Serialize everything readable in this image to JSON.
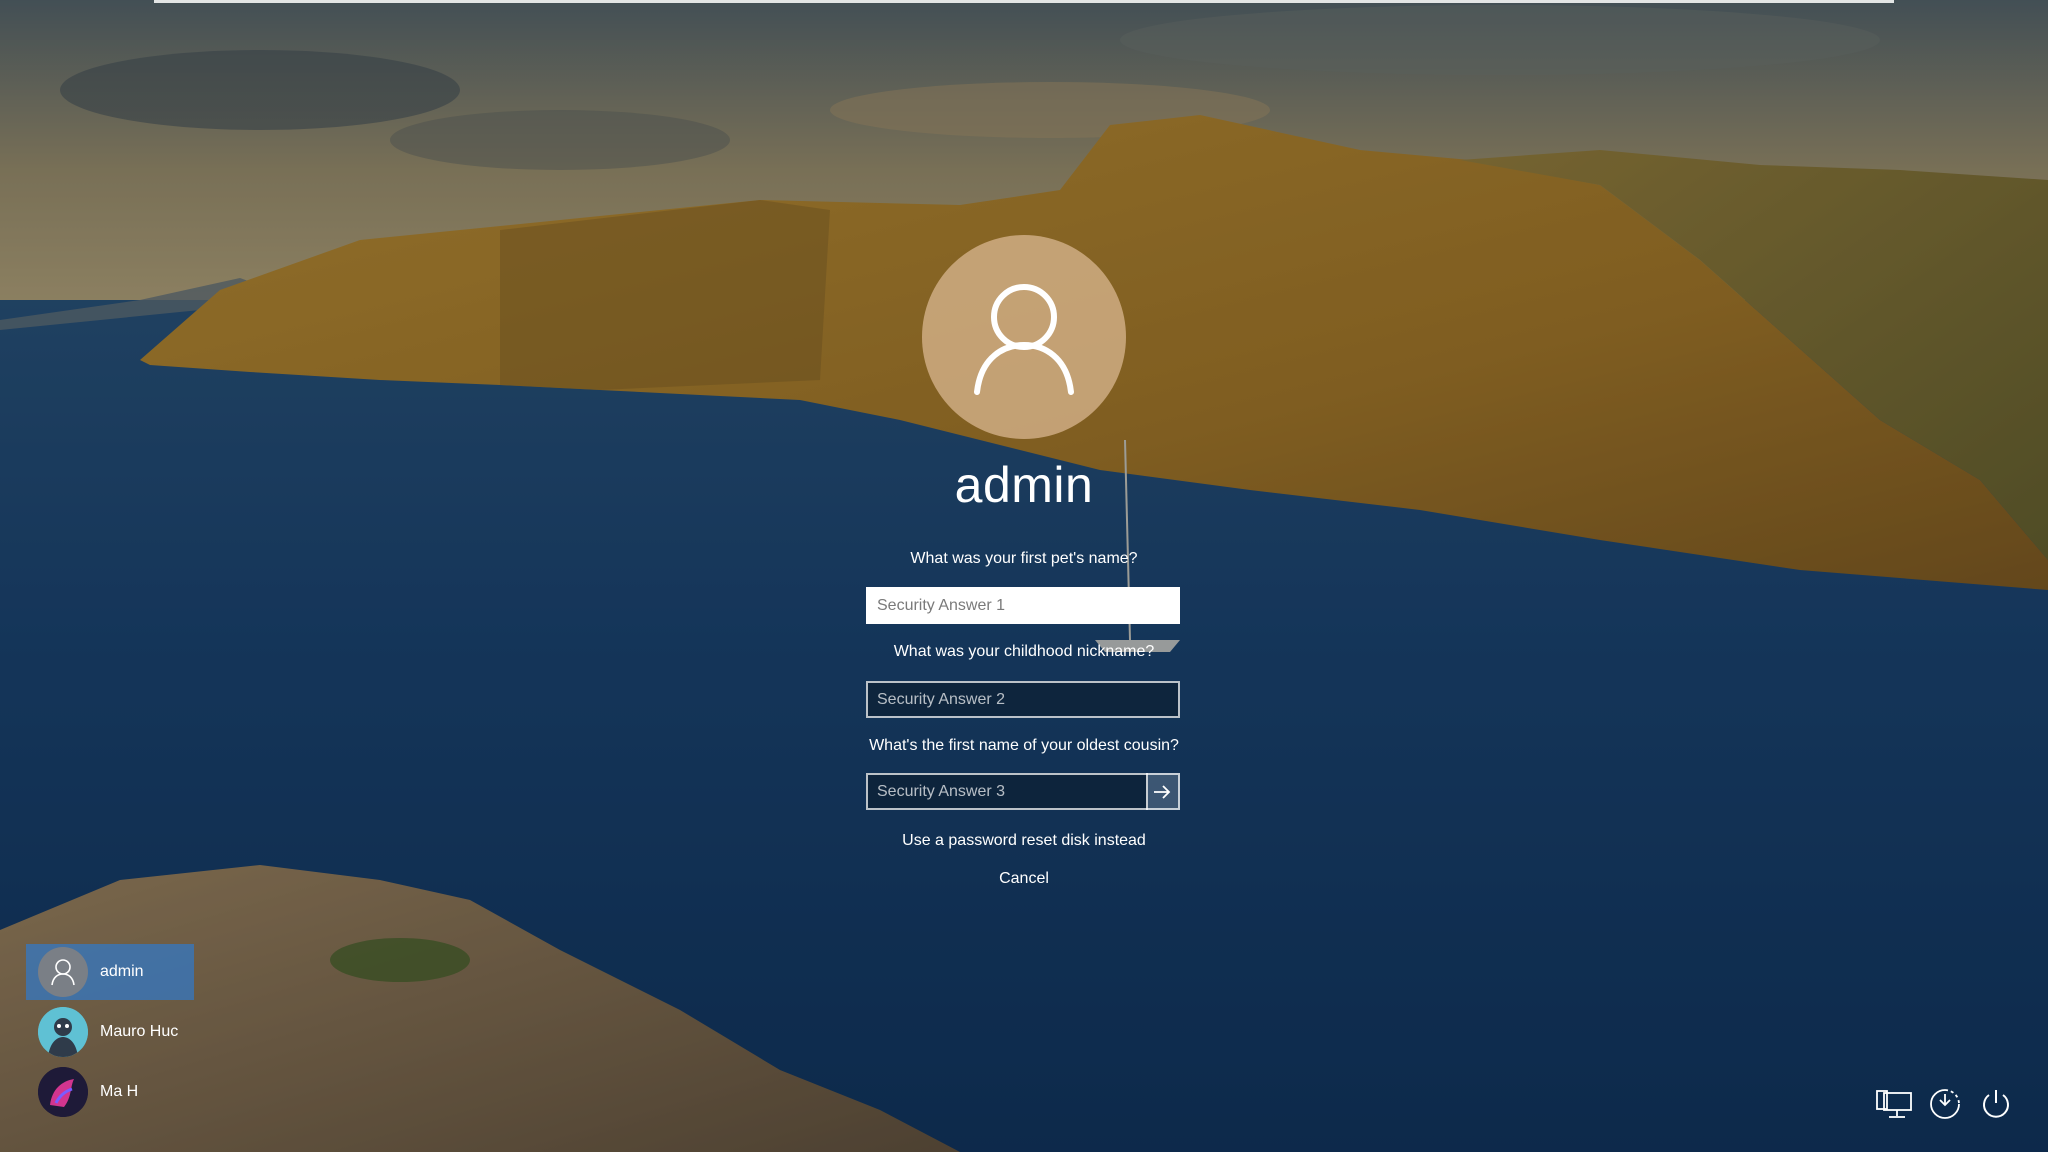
{
  "account": {
    "username": "admin"
  },
  "security_questions": [
    {
      "question": "What was your first pet's name?",
      "placeholder": "Security Answer 1",
      "value": ""
    },
    {
      "question": "What was your childhood nickname?",
      "placeholder": "Security Answer 2",
      "value": ""
    },
    {
      "question": "What's the first name of your oldest cousin?",
      "placeholder": "Security Answer 3",
      "value": ""
    }
  ],
  "links": {
    "reset_disk": "Use a password reset disk instead",
    "cancel": "Cancel"
  },
  "users": [
    {
      "name": "admin",
      "selected": true,
      "icon": "person-icon"
    },
    {
      "name": "Mauro Huc",
      "selected": false,
      "icon": "avatar-illustration"
    },
    {
      "name": "Ma H",
      "selected": false,
      "icon": "avatar-illustration"
    }
  ],
  "system_icons": [
    {
      "name": "network-icon"
    },
    {
      "name": "ease-of-access-icon"
    },
    {
      "name": "power-icon"
    }
  ],
  "colors": {
    "selected_user": "#3278c8",
    "text": "#ffffff",
    "avatar_circle": "#d6b48c"
  }
}
